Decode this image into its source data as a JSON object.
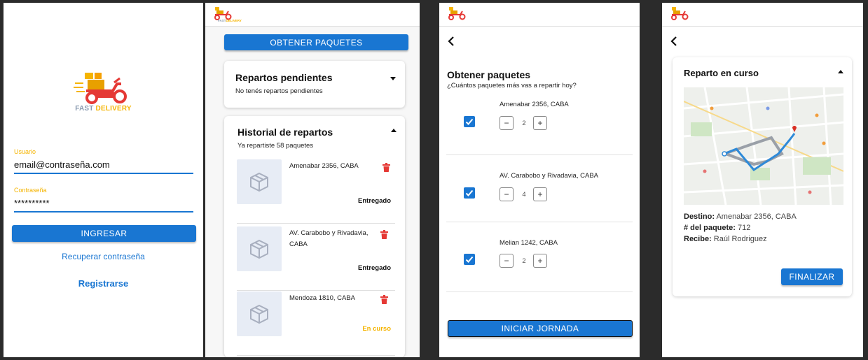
{
  "login": {
    "logo_fast": "FAST",
    "logo_delivery": "DELIVERY",
    "user_label": "Usuario",
    "user_value": "email@contraseña.com",
    "password_label": "Contraseña",
    "password_value": "**********",
    "submit_label": "INGRESAR",
    "recover_label": "Recuperar contraseña",
    "register_label": "Registrarse"
  },
  "header": {
    "logo_fast": "FAST",
    "logo_delivery": "DELIVERY"
  },
  "home": {
    "get_packages_label": "OBTENER PAQUETES",
    "pending": {
      "title": "Repartos pendientes",
      "subtitle": "No tenés repartos pendientes"
    },
    "history": {
      "title": "Historial de repartos",
      "subtitle": "Ya repartiste 58 paquetes",
      "items": [
        {
          "address": "Amenabar 2356, CABA",
          "status": "Entregado",
          "status_color": "#111111"
        },
        {
          "address": "AV. Carabobo y Rivadavia, CABA",
          "status": "Entregado",
          "status_color": "#111111"
        },
        {
          "address": "Mendoza 1810, CABA",
          "status": "En curso",
          "status_color": "#f5b400"
        }
      ]
    }
  },
  "get_packages": {
    "title": "Obtener paquetes",
    "subtitle": "¿Cuántos paquetes más vas a repartir hoy?",
    "packages": [
      {
        "address": "Amenabar 2356, CABA",
        "quantity": "2",
        "checked": true
      },
      {
        "address": "AV. Carabobo y Rivadavia, CABA",
        "quantity": "4",
        "checked": true
      },
      {
        "address": "Melian 1242, CABA",
        "quantity": "2",
        "checked": true
      }
    ],
    "start_label": "INICIAR JORNADA"
  },
  "delivery": {
    "title": "Reparto en curso",
    "destination_label": "Destino:",
    "destination_value": " Amenabar 2356, CABA",
    "package_label": "# del paquete:",
    "package_value": " 712",
    "receiver_label": "Recibe:",
    "receiver_value": " Raúl Rodriguez",
    "finish_label": "FINALIZAR"
  },
  "colors": {
    "primary": "#1976d2",
    "accent_yellow": "#f5b400",
    "delete_red": "#e53935"
  }
}
